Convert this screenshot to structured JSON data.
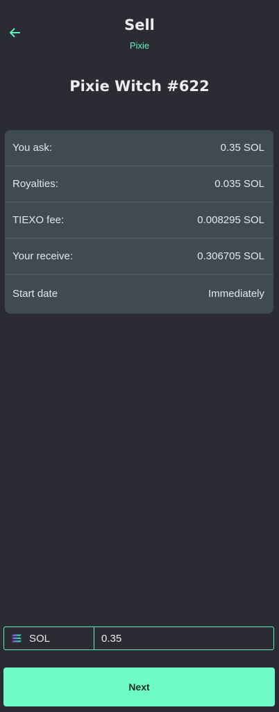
{
  "header": {
    "title": "Sell",
    "subtitle": "Pixie"
  },
  "nft": {
    "name": "Pixie Witch #622"
  },
  "summary": {
    "rows": [
      {
        "label": "You ask:",
        "value": "0.35 SOL"
      },
      {
        "label": "Royalties:",
        "value": "0.035 SOL"
      },
      {
        "label": "TIEXO fee:",
        "value": "0.008295 SOL"
      },
      {
        "label": "Your receive:",
        "value": "0.306705 SOL"
      },
      {
        "label": "Start date",
        "value": "Immediately"
      }
    ]
  },
  "price_input": {
    "currency": "SOL",
    "value": "0.35"
  },
  "next_button": {
    "label": "Next"
  },
  "colors": {
    "background": "#2a2b33",
    "accent": "#62f0b8",
    "button": "#6ffbc6",
    "card": "#3f4a52"
  },
  "icons": {
    "back": "arrow-left-icon",
    "currency": "solana-icon"
  }
}
